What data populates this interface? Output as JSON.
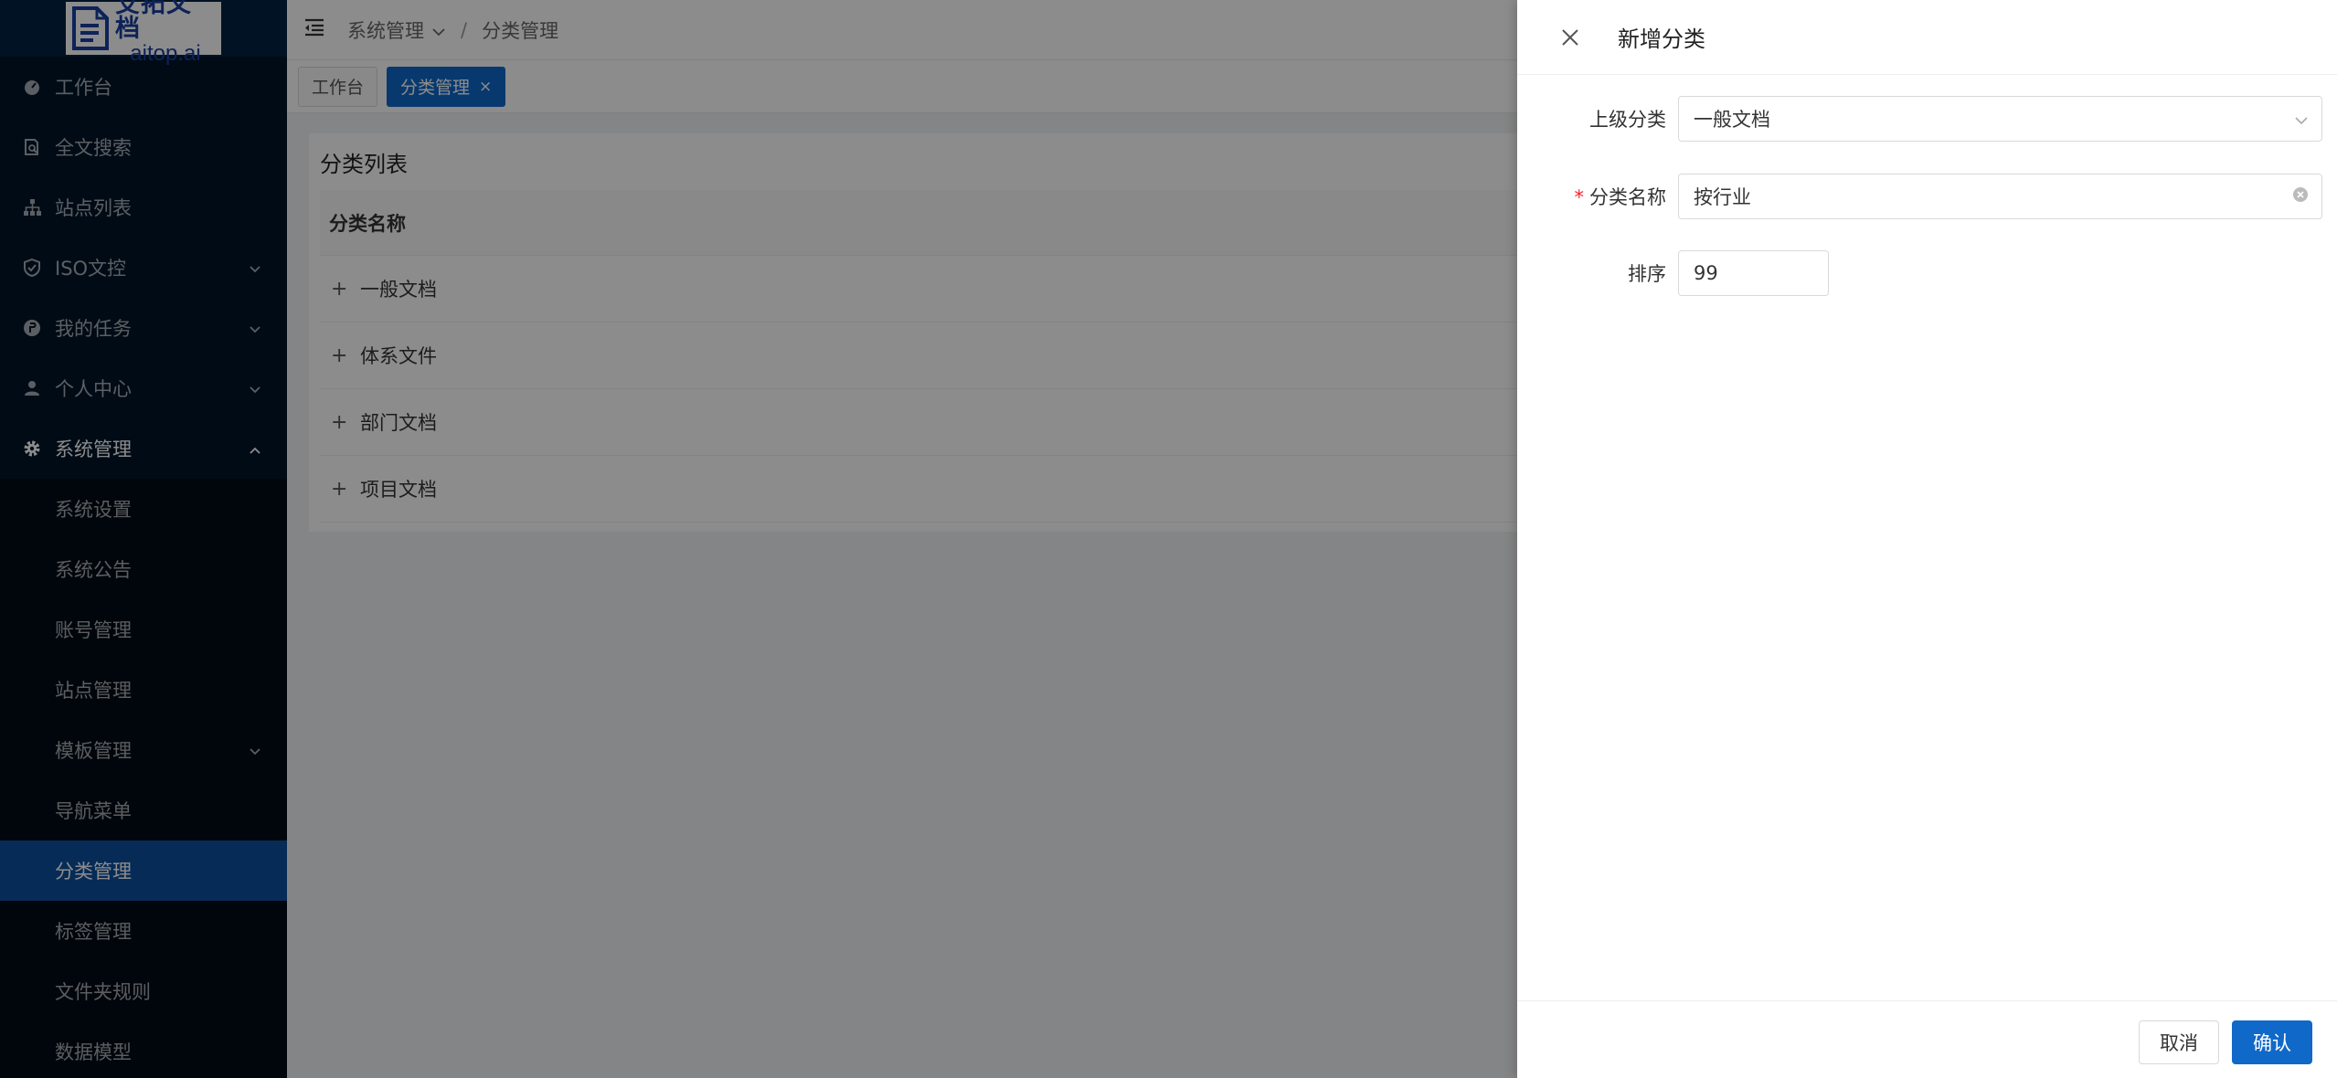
{
  "logo": {
    "cn": "艾拓文档",
    "en": "aitop.ai"
  },
  "sidebar": {
    "items": [
      {
        "label": "工作台",
        "icon": "dashboard-icon"
      },
      {
        "label": "全文搜索",
        "icon": "file-search-icon"
      },
      {
        "label": "站点列表",
        "icon": "sitemap-icon"
      },
      {
        "label": "ISO文控",
        "icon": "shield-icon",
        "has_children": true
      },
      {
        "label": "我的任务",
        "icon": "task-icon",
        "has_children": true
      },
      {
        "label": "个人中心",
        "icon": "user-icon",
        "has_children": true
      },
      {
        "label": "系统管理",
        "icon": "gear-icon",
        "has_children": true,
        "open": true
      }
    ],
    "submenu": [
      {
        "label": "系统设置"
      },
      {
        "label": "系统公告"
      },
      {
        "label": "账号管理"
      },
      {
        "label": "站点管理"
      },
      {
        "label": "模板管理",
        "has_children": true
      },
      {
        "label": "导航菜单"
      },
      {
        "label": "分类管理",
        "active": true
      },
      {
        "label": "标签管理"
      },
      {
        "label": "文件夹规则"
      },
      {
        "label": "数据模型"
      }
    ]
  },
  "header": {
    "breadcrumb": {
      "parent": "系统管理",
      "current": "分类管理",
      "separator": "/"
    }
  },
  "tabs": [
    {
      "label": "工作台",
      "active": false
    },
    {
      "label": "分类管理",
      "active": true,
      "close": "×"
    }
  ],
  "card": {
    "title": "分类列表",
    "column_header": "分类名称",
    "rows": [
      "一般文档",
      "体系文件",
      "部门文档",
      "项目文档"
    ],
    "expand_symbol": "+"
  },
  "drawer": {
    "title": "新增分类",
    "fields": {
      "parent": {
        "label": "上级分类",
        "value": "一般文档"
      },
      "name": {
        "label": "分类名称",
        "value": "按行业",
        "required_mark": "*"
      },
      "order": {
        "label": "排序",
        "value": "99"
      }
    },
    "cancel_label": "取消",
    "ok_label": "确认"
  },
  "colors": {
    "sidebar_bg": "#001529",
    "primary": "#1068c9",
    "required": "#f5222d"
  }
}
